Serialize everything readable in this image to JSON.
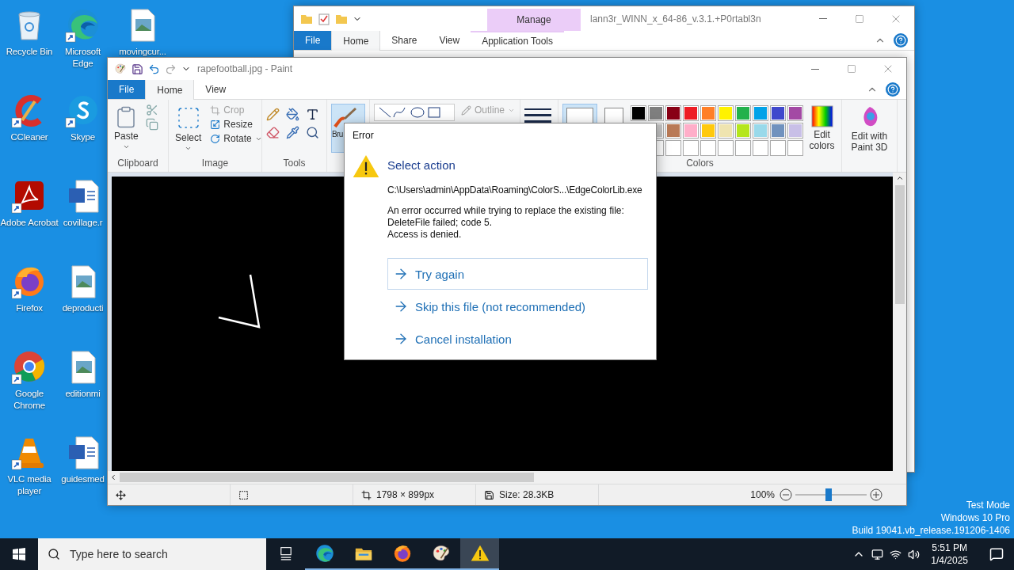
{
  "desktop": {
    "columns": [
      [
        {
          "label": "Recycle Bin",
          "kind": "recycle",
          "shortcut": false
        },
        {
          "label": "CCleaner",
          "kind": "ccleaner",
          "shortcut": true
        },
        {
          "label": "Adobe Acrobat",
          "kind": "acrobat",
          "shortcut": true
        },
        {
          "label": "Firefox",
          "kind": "firefox",
          "shortcut": true
        },
        {
          "label": "Google Chrome",
          "kind": "chrome",
          "shortcut": true
        },
        {
          "label": "VLC media player",
          "kind": "vlc",
          "shortcut": true
        }
      ],
      [
        {
          "label": "Microsoft Edge",
          "kind": "edge",
          "shortcut": true
        },
        {
          "label": "Skype",
          "kind": "skype",
          "shortcut": true
        },
        {
          "label": "covillage.r",
          "kind": "word",
          "shortcut": false
        },
        {
          "label": "deproducti",
          "kind": "image",
          "shortcut": false
        },
        {
          "label": "editionmi",
          "kind": "image",
          "shortcut": false
        },
        {
          "label": "guidesmed",
          "kind": "word",
          "shortcut": false
        }
      ],
      [
        {
          "label": "movingcur...",
          "kind": "image",
          "shortcut": false
        }
      ]
    ]
  },
  "explorer": {
    "title": "lann3r_WINN_x_64-86_v.3.1.+P0rtabl3n",
    "context_tab": "Manage",
    "tabs": [
      {
        "label": "File",
        "kind": "file",
        "selected": false
      },
      {
        "label": "Home",
        "kind": "tab",
        "selected": true
      },
      {
        "label": "Share",
        "kind": "tab",
        "selected": false
      },
      {
        "label": "View",
        "kind": "tab",
        "selected": false
      },
      {
        "label": "Application Tools",
        "kind": "context",
        "selected": false
      }
    ]
  },
  "paint": {
    "title": "rapefootball.jpg - Paint",
    "tabs": [
      {
        "label": "File",
        "kind": "file",
        "selected": false
      },
      {
        "label": "Home",
        "kind": "tab",
        "selected": true
      },
      {
        "label": "View",
        "kind": "tab",
        "selected": false
      }
    ],
    "ribbon": {
      "paste": "Paste",
      "clipboard_group": "Clipboard",
      "select": "Select",
      "image_tools": [
        {
          "label": "Crop",
          "kind": "crop",
          "disabled": true
        },
        {
          "label": "Resize",
          "kind": "resize",
          "disabled": false
        },
        {
          "label": "Rotate",
          "kind": "rotate",
          "disabled": false
        }
      ],
      "image_group": "Image",
      "tools_group": "Tools",
      "brushes": "Bru",
      "outline": "Outline",
      "color_1": {
        "color": "#ffffff",
        "selected": true
      },
      "color_2": {
        "color": "#ffffff",
        "selected": false
      },
      "palette": [
        {
          "color": "#000000"
        },
        {
          "color": "#7f7f7f"
        },
        {
          "color": "#880015"
        },
        {
          "color": "#ed1c24"
        },
        {
          "color": "#ff7f27"
        },
        {
          "color": "#fff200"
        },
        {
          "color": "#22b14c"
        },
        {
          "color": "#00a2e8"
        },
        {
          "color": "#3f48cc"
        },
        {
          "color": "#a349a4"
        },
        {
          "color": "#c3c3c3"
        },
        {
          "color": "#b97a57"
        },
        {
          "color": "#ffaec9"
        },
        {
          "color": "#ffc90e"
        },
        {
          "color": "#efe4b0"
        },
        {
          "color": "#b5e61d"
        },
        {
          "color": "#99d9ea"
        },
        {
          "color": "#7092be"
        },
        {
          "color": "#c8bfe7"
        }
      ],
      "edit_colors": "Edit colors",
      "colors_group": "Colors",
      "paint3d": "Edit with Paint 3D"
    },
    "status": {
      "dimensions": "1798 × 899px",
      "size": "Size: 28.3KB",
      "zoom": "100%",
      "zoom_slider": {
        "level": 0.47
      }
    }
  },
  "dialog": {
    "title": "Error",
    "heading": "Select action",
    "path": "C:\\Users\\admin\\AppData\\Roaming\\ColorS...\\EdgeColorLib.exe",
    "message": [
      "An error occurred while trying to replace the existing file:",
      "DeleteFile failed; code 5.",
      "Access is denied."
    ],
    "options": [
      {
        "label": "Try again",
        "selected": true
      },
      {
        "label": "Skip this file (not recommended)",
        "selected": false
      },
      {
        "label": "Cancel installation",
        "selected": false
      }
    ]
  },
  "system": {
    "lines": [
      "Test Mode",
      "Windows 10 Pro",
      "Build 19041.vb_release.191206-1406"
    ]
  },
  "taskbar": {
    "search": {
      "placeholder": "Type here to search"
    },
    "apps": [
      {
        "kind": "taskview",
        "running": false,
        "selected": false
      },
      {
        "kind": "edge",
        "running": true,
        "selected": false
      },
      {
        "kind": "explorer",
        "running": true,
        "selected": false
      },
      {
        "kind": "firefox",
        "running": true,
        "selected": false
      },
      {
        "kind": "paint",
        "running": true,
        "selected": false
      },
      {
        "kind": "warning",
        "running": true,
        "selected": true
      }
    ],
    "time": "5:51 PM",
    "date": "1/4/2025"
  }
}
